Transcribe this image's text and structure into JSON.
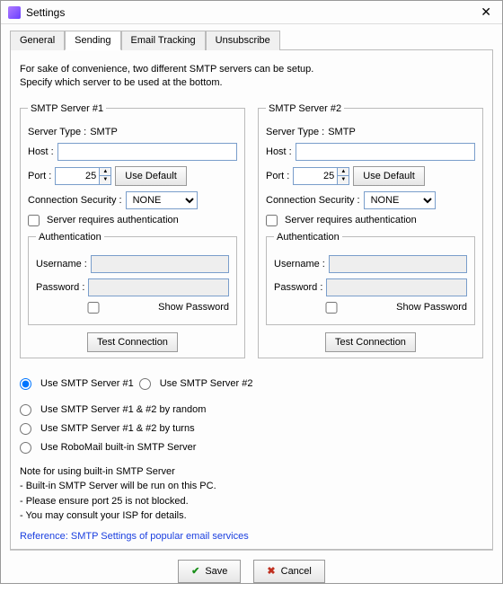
{
  "window": {
    "title": "Settings"
  },
  "tabs": {
    "general": "General",
    "sending": "Sending",
    "email_tracking": "Email Tracking",
    "unsubscribe": "Unsubscribe"
  },
  "intro": {
    "line1": "For sake of convenience, two different SMTP servers can be setup.",
    "line2": "Specify which server to be used at the bottom."
  },
  "server1": {
    "legend": "SMTP Server #1",
    "server_type_label": "Server Type :",
    "server_type_value": "SMTP",
    "host_label": "Host :",
    "host_value": "",
    "port_label": "Port :",
    "port_value": "25",
    "use_default": "Use Default",
    "conn_sec_label": "Connection Security :",
    "conn_sec_value": "NONE",
    "req_auth": "Server requires authentication",
    "auth_legend": "Authentication",
    "username_label": "Username :",
    "username_value": "",
    "password_label": "Password :",
    "password_value": "",
    "show_pw": "Show Password",
    "test": "Test Connection"
  },
  "server2": {
    "legend": "SMTP Server #2",
    "server_type_label": "Server Type :",
    "server_type_value": "SMTP",
    "host_label": "Host :",
    "host_value": "",
    "port_label": "Port :",
    "port_value": "25",
    "use_default": "Use Default",
    "conn_sec_label": "Connection Security :",
    "conn_sec_value": "NONE",
    "req_auth": "Server requires authentication",
    "auth_legend": "Authentication",
    "username_label": "Username :",
    "username_value": "",
    "password_label": "Password :",
    "password_value": "",
    "show_pw": "Show Password",
    "test": "Test Connection"
  },
  "radios": {
    "use1": "Use SMTP Server #1",
    "use2": "Use SMTP Server #2",
    "random": "Use SMTP Server #1 & #2 by random",
    "turns": "Use SMTP Server #1 & #2 by turns",
    "builtin": "Use RoboMail built-in SMTP Server"
  },
  "note": {
    "title": "Note for using built-in SMTP Server",
    "l1": "- Built-in SMTP Server will be run on this PC.",
    "l2": "- Please ensure port 25 is not blocked.",
    "l3": "- You may consult your ISP for details."
  },
  "reference_link": "Reference: SMTP Settings of popular email services",
  "buttons": {
    "save": "Save",
    "cancel": "Cancel"
  }
}
